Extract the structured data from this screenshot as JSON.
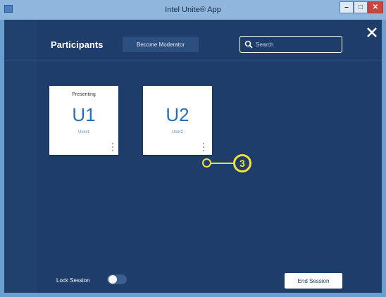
{
  "window": {
    "title": "Intel Unite® App",
    "minimize_glyph": "–",
    "maximize_glyph": "□",
    "close_glyph": "✕"
  },
  "header": {
    "title": "Participants",
    "become_moderator_label": "Become Moderator",
    "search_placeholder": "Search"
  },
  "participants": [
    {
      "status": "Presenting",
      "initials": "U1",
      "name": "User1"
    },
    {
      "status": "",
      "initials": "U2",
      "name": "User2"
    }
  ],
  "callout": {
    "number": "3"
  },
  "footer": {
    "lock_session_label": "Lock Session",
    "lock_session_on": false,
    "end_session_label": "End Session"
  },
  "colors": {
    "app_background": "#1e3d6b",
    "accent_blue": "#2a6fb6",
    "callout_yellow": "#f2e23a"
  },
  "icons": {
    "app": "app-window-icon",
    "search": "search-icon",
    "close": "close-icon",
    "more": "more-options-icon"
  }
}
